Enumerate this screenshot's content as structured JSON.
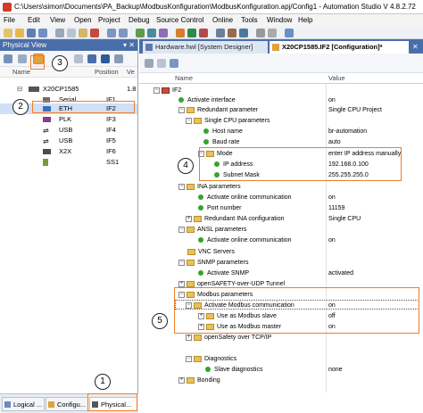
{
  "window": {
    "title": "C:\\Users\\simon\\Documents\\PA_Backup\\ModbusKonfiguration\\ModbusKonfiguration.apj/Config1 - Automation Studio V 4.8.2.72"
  },
  "menu": [
    "File",
    "Edit",
    "View",
    "Open",
    "Project",
    "Debug",
    "Source Control",
    "Online",
    "Tools",
    "Window",
    "Help"
  ],
  "physical_view": {
    "title": "Physical View",
    "pin_label": "▾ ✕",
    "columns": {
      "name": "Name",
      "position": "Position",
      "version": "Ve"
    },
    "version_value": "1.8",
    "tree": [
      {
        "name": "X20CP1585",
        "position": "",
        "icon": "cpu-icon"
      },
      {
        "name": "Serial",
        "position": "IF1",
        "icon": "serial-icon"
      },
      {
        "name": "ETH",
        "position": "IF2",
        "icon": "ethernet-icon"
      },
      {
        "name": "PLK",
        "position": "IF3",
        "icon": "powerlink-icon"
      },
      {
        "name": "USB",
        "position": "IF4",
        "icon": "usb-icon"
      },
      {
        "name": "USB",
        "position": "IF5",
        "icon": "usb-icon"
      },
      {
        "name": "X2X",
        "position": "IF6",
        "icon": "x2x-icon"
      },
      {
        "name": "",
        "position": "SS1",
        "icon": "slot-icon"
      }
    ],
    "bottom_tabs": [
      "Logical ...",
      "Configu...",
      "Physical..."
    ]
  },
  "editor_tabs": [
    {
      "label": "Hardware.hwl [System Designer]"
    },
    {
      "label": "X20CP1585.IF2 [Configuration]*"
    }
  ],
  "editor_tab_close": "✕",
  "grid": {
    "col_name": "Name",
    "col_value": "Value",
    "rows": [
      {
        "name": "IF2",
        "value": "",
        "indent": 0,
        "kind": "folder"
      },
      {
        "name": "Activate interface",
        "value": "on",
        "indent": 1,
        "kind": "dot"
      },
      {
        "name": "Redundant parameter",
        "value": "Single CPU Project",
        "indent": 2,
        "kind": "folder"
      },
      {
        "name": "Single CPU parameters",
        "value": "",
        "indent": 3,
        "kind": "folder"
      },
      {
        "name": "Host name",
        "value": "br-automation",
        "indent": 4,
        "kind": "dot"
      },
      {
        "name": "Baud rate",
        "value": "auto",
        "indent": 4,
        "kind": "dot"
      },
      {
        "name": "Mode",
        "value": "enter IP address manually",
        "indent": 4,
        "kind": "folder"
      },
      {
        "name": "IP address",
        "value": "192.168.0.100",
        "indent": 5,
        "kind": "dot"
      },
      {
        "name": "Subnet Mask",
        "value": "255.255.255.0",
        "indent": 5,
        "kind": "dot"
      },
      {
        "name": "INA parameters",
        "value": "",
        "indent": 2,
        "kind": "folder"
      },
      {
        "name": "Activate online communication",
        "value": "on",
        "indent": 3,
        "kind": "dot"
      },
      {
        "name": "Port number",
        "value": "11159",
        "indent": 3,
        "kind": "dot"
      },
      {
        "name": "Redundant INA configuration",
        "value": "Single CPU",
        "indent": 3,
        "kind": "folder"
      },
      {
        "name": "ANSL parameters",
        "value": "",
        "indent": 2,
        "kind": "folder"
      },
      {
        "name": "Activate online communication",
        "value": "on",
        "indent": 3,
        "kind": "dot"
      },
      {
        "name": "VNC Servers",
        "value": "",
        "indent": 2,
        "kind": "folder"
      },
      {
        "name": "SNMP parameters",
        "value": "",
        "indent": 2,
        "kind": "folder"
      },
      {
        "name": "Activate SNMP",
        "value": "activated",
        "indent": 3,
        "kind": "dot"
      },
      {
        "name": "openSAFETY-over-UDP Tunnel",
        "value": "",
        "indent": 2,
        "kind": "folder"
      },
      {
        "name": "Modbus parameters",
        "value": "",
        "indent": 2,
        "kind": "folder"
      },
      {
        "name": "Activate Modbus communication",
        "value": "on",
        "indent": 3,
        "kind": "folder"
      },
      {
        "name": "Use as Modbus slave",
        "value": "off",
        "indent": 4,
        "kind": "folder"
      },
      {
        "name": "Use as Modbus master",
        "value": "on",
        "indent": 4,
        "kind": "folder"
      },
      {
        "name": "openSafety over TCP/IP",
        "value": "",
        "indent": 3,
        "kind": "folder"
      },
      {
        "name": "Diagnostics",
        "value": "",
        "indent": 3,
        "kind": "folder"
      },
      {
        "name": "Slave diagnostics",
        "value": "none",
        "indent": 4,
        "kind": "dot"
      },
      {
        "name": "Bonding",
        "value": "",
        "indent": 2,
        "kind": "folder"
      }
    ]
  },
  "callouts": [
    "1",
    "2",
    "3",
    "4",
    "5"
  ],
  "colors": {
    "accent": "#4a6ea9",
    "callout": "#f07d2a",
    "active_green": "#37a32e"
  }
}
